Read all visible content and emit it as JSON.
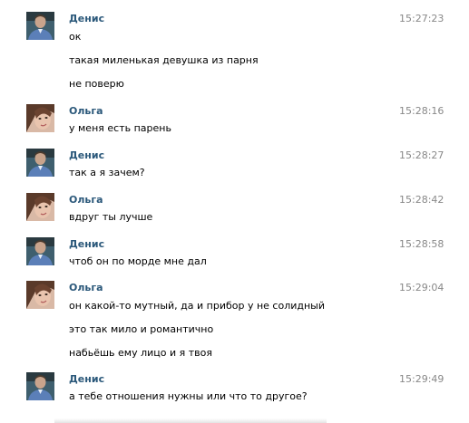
{
  "colors": {
    "author": "#2b587a",
    "time": "#888888",
    "text": "#000000",
    "background": "#ffffff"
  },
  "groups": [
    {
      "author": "Денис",
      "avatar": "male-user-avatar",
      "time": "15:27:23",
      "messages": [
        "ок",
        "такая миленькая девушка из парня",
        "не поверю"
      ]
    },
    {
      "author": "Ольга",
      "avatar": "female-user-avatar",
      "time": "15:28:16",
      "messages": [
        "у меня есть парень"
      ]
    },
    {
      "author": "Денис",
      "avatar": "male-user-avatar",
      "time": "15:28:27",
      "messages": [
        "так а я зачем?"
      ]
    },
    {
      "author": "Ольга",
      "avatar": "female-user-avatar",
      "time": "15:28:42",
      "messages": [
        "вдруг ты лучше"
      ]
    },
    {
      "author": "Денис",
      "avatar": "male-user-avatar",
      "time": "15:28:58",
      "messages": [
        "чтоб он по морде мне дал"
      ]
    },
    {
      "author": "Ольга",
      "avatar": "female-user-avatar",
      "time": "15:29:04",
      "messages": [
        "он какой-то мутный, да и прибор у не солидный",
        "это так мило и романтично",
        "набьёшь ему лицо и я твоя"
      ]
    },
    {
      "author": "Денис",
      "avatar": "male-user-avatar",
      "time": "15:29:49",
      "messages": [
        "а тебе отношения нужны или что то другое?"
      ]
    }
  ]
}
